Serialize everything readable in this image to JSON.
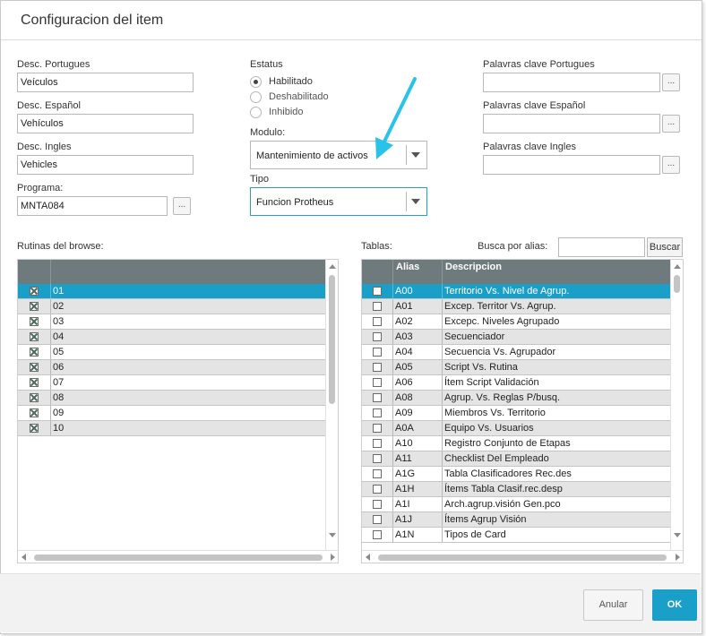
{
  "dialog": {
    "title": "Configuracion del item"
  },
  "left_fields": {
    "desc_portugues": {
      "label": "Desc. Portugues",
      "value": "Veículos"
    },
    "desc_espanol": {
      "label": "Desc. Español",
      "value": "Vehículos"
    },
    "desc_ingles": {
      "label": "Desc. Ingles",
      "value": "Vehicles"
    },
    "programa": {
      "label": "Programa:",
      "value": "MNTA084",
      "button": "..."
    }
  },
  "estatus": {
    "label": "Estatus",
    "options": [
      {
        "label": "Habilitado",
        "selected": true
      },
      {
        "label": "Deshabilitado",
        "selected": false
      },
      {
        "label": "Inhibido",
        "selected": false
      }
    ]
  },
  "modulo": {
    "label": "Modulo:",
    "value": "Mantenimiento de activos"
  },
  "tipo": {
    "label": "Tipo",
    "value": "Funcion Protheus"
  },
  "keywords": {
    "portugues": {
      "label": "Palavras clave Portugues",
      "value": "",
      "button": "..."
    },
    "espanol": {
      "label": "Palavras clave Español",
      "value": "",
      "button": "..."
    },
    "ingles": {
      "label": "Palavras clave Ingles",
      "value": "",
      "button": "..."
    }
  },
  "browse": {
    "label": "Rutinas del browse:",
    "rows": [
      {
        "value": "01",
        "checked": true,
        "selected": true
      },
      {
        "value": "02",
        "checked": true
      },
      {
        "value": "03",
        "checked": true
      },
      {
        "value": "04",
        "checked": true
      },
      {
        "value": "05",
        "checked": true
      },
      {
        "value": "06",
        "checked": true
      },
      {
        "value": "07",
        "checked": true
      },
      {
        "value": "08",
        "checked": true
      },
      {
        "value": "09",
        "checked": true
      },
      {
        "value": "10",
        "checked": true
      }
    ]
  },
  "tablas": {
    "label": "Tablas:",
    "search_label": "Busca por alias:",
    "search_value": "",
    "search_button": "Buscar",
    "columns": {
      "alias": "Alias",
      "descripcion": "Descripcion"
    },
    "rows": [
      {
        "alias": "A00",
        "descripcion": "Territorio Vs. Nivel de Agrup.",
        "selected": true
      },
      {
        "alias": "A01",
        "descripcion": "Excep. Territor Vs. Agrup."
      },
      {
        "alias": "A02",
        "descripcion": "Excepc. Niveles Agrupado"
      },
      {
        "alias": "A03",
        "descripcion": "Secuenciador"
      },
      {
        "alias": "A04",
        "descripcion": "Secuencia Vs. Agrupador"
      },
      {
        "alias": "A05",
        "descripcion": "Script Vs. Rutina"
      },
      {
        "alias": "A06",
        "descripcion": "Ítem Script Validación"
      },
      {
        "alias": "A08",
        "descripcion": "Agrup. Vs. Reglas P/busq."
      },
      {
        "alias": "A09",
        "descripcion": "Miembros Vs. Territorio"
      },
      {
        "alias": "A0A",
        "descripcion": "Equipo Vs. Usuarios"
      },
      {
        "alias": "A10",
        "descripcion": "Registro Conjunto de Etapas"
      },
      {
        "alias": "A11",
        "descripcion": "Checklist Del Empleado"
      },
      {
        "alias": "A1G",
        "descripcion": "Tabla Clasificadores Rec.des"
      },
      {
        "alias": "A1H",
        "descripcion": "Ítems Tabla Clasif.rec.desp"
      },
      {
        "alias": "A1I",
        "descripcion": "Arch.agrup.visión Gen.pco"
      },
      {
        "alias": "A1J",
        "descripcion": "Ítems Agrup Visión"
      },
      {
        "alias": "A1N",
        "descripcion": "Tipos de Card"
      }
    ]
  },
  "footer": {
    "cancel_label": "Anular",
    "ok_label": "OK"
  },
  "colors": {
    "accent": "#1aa0c8",
    "header_gray": "#6e7a7c",
    "annotation_arrow": "#29c3ea"
  }
}
